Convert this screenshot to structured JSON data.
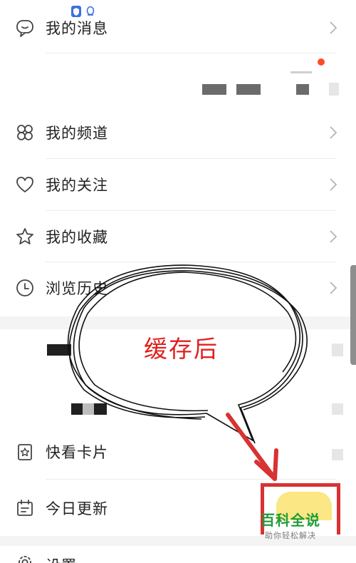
{
  "status": {
    "shield_icon": "shield-icon",
    "qq_icon": "qq-icon"
  },
  "menu": {
    "messages": "我的消息",
    "channels": "我的频道",
    "follow": "我的关注",
    "favorites": "我的收藏",
    "history": "浏览历史",
    "quick_cards": "快看卡片",
    "today_update": "今日更新",
    "settings": "设置"
  },
  "annotation": {
    "bubble_text": "缓存后"
  },
  "watermark": {
    "title": "百科全说",
    "subtitle": "助你轻松解决"
  },
  "colors": {
    "accent_red": "#e02020",
    "notification_dot": "#ff4a2a",
    "watermark_green": "#1f9c3a"
  }
}
